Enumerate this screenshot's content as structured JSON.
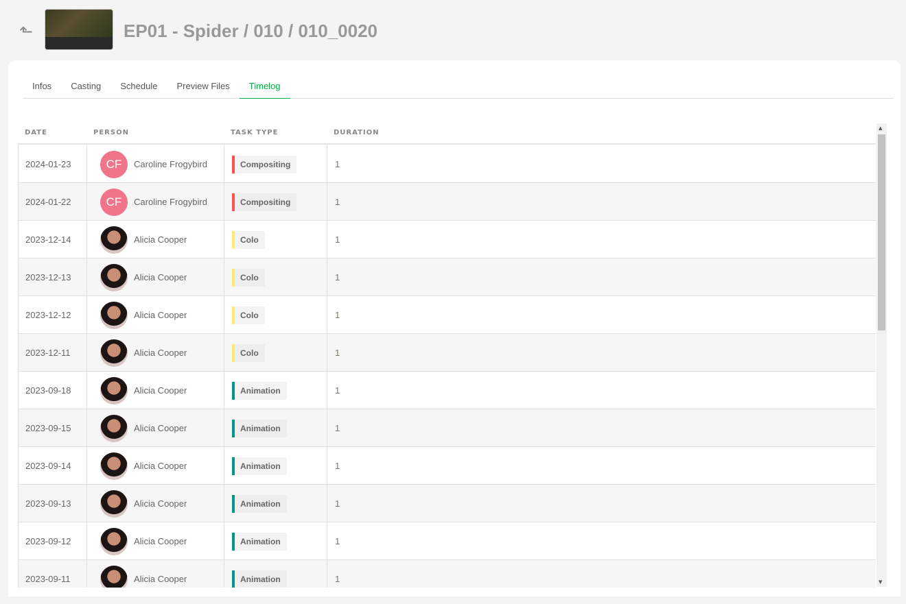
{
  "header": {
    "title": "EP01 - Spider / 010 / 010_0020",
    "back_icon": "arrow-turn-up"
  },
  "tabs": [
    {
      "label": "Infos"
    },
    {
      "label": "Casting"
    },
    {
      "label": "Schedule"
    },
    {
      "label": "Preview Files"
    },
    {
      "label": "Timelog",
      "active": true
    }
  ],
  "accent": "#00b242",
  "table": {
    "headers": [
      "DATE",
      "PERSON",
      "TASK TYPE",
      "DURATION"
    ],
    "rows": [
      {
        "date": "2024-01-23",
        "person": "Caroline Frogybird",
        "initials": "CF",
        "task": "Compositing",
        "color": "#ff5252",
        "duration": "1"
      },
      {
        "date": "2024-01-22",
        "person": "Caroline Frogybird",
        "initials": "CF",
        "task": "Compositing",
        "color": "#ff5252",
        "duration": "1"
      },
      {
        "date": "2023-12-14",
        "person": "Alicia Cooper",
        "task": "Colo",
        "color": "#ffeb70",
        "duration": "1"
      },
      {
        "date": "2023-12-13",
        "person": "Alicia Cooper",
        "task": "Colo",
        "color": "#ffeb70",
        "duration": "1"
      },
      {
        "date": "2023-12-12",
        "person": "Alicia Cooper",
        "task": "Colo",
        "color": "#ffeb70",
        "duration": "1"
      },
      {
        "date": "2023-12-11",
        "person": "Alicia Cooper",
        "task": "Colo",
        "color": "#ffeb70",
        "duration": "1"
      },
      {
        "date": "2023-09-18",
        "person": "Alicia Cooper",
        "task": "Animation",
        "color": "#009688",
        "duration": "1"
      },
      {
        "date": "2023-09-15",
        "person": "Alicia Cooper",
        "task": "Animation",
        "color": "#009688",
        "duration": "1"
      },
      {
        "date": "2023-09-14",
        "person": "Alicia Cooper",
        "task": "Animation",
        "color": "#009688",
        "duration": "1"
      },
      {
        "date": "2023-09-13",
        "person": "Alicia Cooper",
        "task": "Animation",
        "color": "#009688",
        "duration": "1"
      },
      {
        "date": "2023-09-12",
        "person": "Alicia Cooper",
        "task": "Animation",
        "color": "#009688",
        "duration": "1"
      },
      {
        "date": "2023-09-11",
        "person": "Alicia Cooper",
        "task": "Animation",
        "color": "#009688",
        "duration": "1"
      }
    ]
  }
}
